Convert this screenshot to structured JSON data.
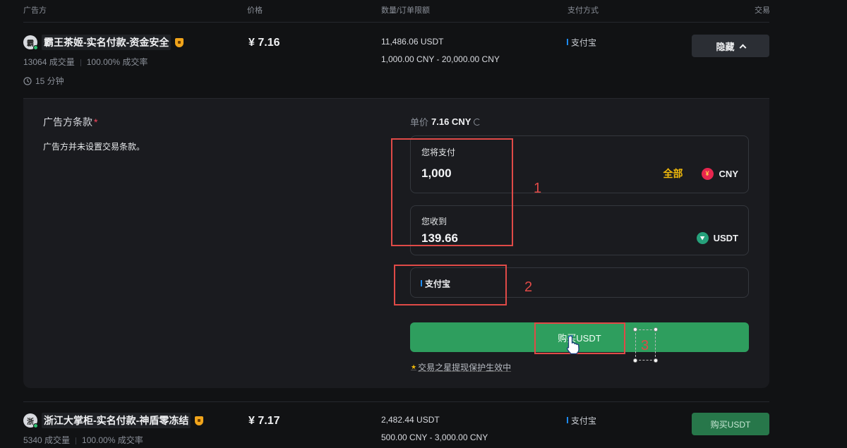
{
  "columns": {
    "advertiser": "广告方",
    "price": "价格",
    "quantity": "数量/订单限额",
    "payment": "支付方式",
    "trade": "交易"
  },
  "listing1": {
    "avatar_char": "霸",
    "name": "霸王茶姬-实名付款-资金安全",
    "orders": "13064 成交量",
    "completion": "100.00% 成交率",
    "time": "15 分钟",
    "price": "¥ 7.16",
    "quantity": "11,486.06 USDT",
    "limit": "1,000.00 CNY - 20,000.00 CNY",
    "payment": "支付宝",
    "action": "隐藏"
  },
  "detail": {
    "terms_title": "广告方条款",
    "terms_required": "*",
    "terms_body": "广告方并未设置交易条款。",
    "unit_price_label": "单价",
    "unit_price_value": "7.16 CNY",
    "pay_label": "您将支付",
    "pay_amount": "1,000",
    "all_label": "全部",
    "pay_currency": "CNY",
    "cny_glyph": "¥",
    "receive_label": "您收到",
    "receive_amount": "139.66",
    "receive_currency": "USDT",
    "payment_method": "支付宝",
    "buy_button": "购买USDT",
    "protection_text": "交易之星提现保护生效中"
  },
  "listing2": {
    "avatar_char": "浙",
    "name": "浙江大掌柜-实名付款-神盾零冻结",
    "orders": "5340 成交量",
    "completion": "100.00% 成交率",
    "price": "¥ 7.17",
    "quantity": "2,482.44 USDT",
    "limit": "500.00 CNY - 3,000.00 CNY",
    "payment": "支付宝",
    "action": "购买USDT"
  },
  "annotations": {
    "label1": "1",
    "label2": "2",
    "label3": "3"
  },
  "colors": {
    "background": "#111214",
    "panel": "#1a1b1f",
    "buy_green": "#2e9e5e",
    "accent_yellow": "#f0b90b",
    "annotation_red": "#e04a47"
  }
}
